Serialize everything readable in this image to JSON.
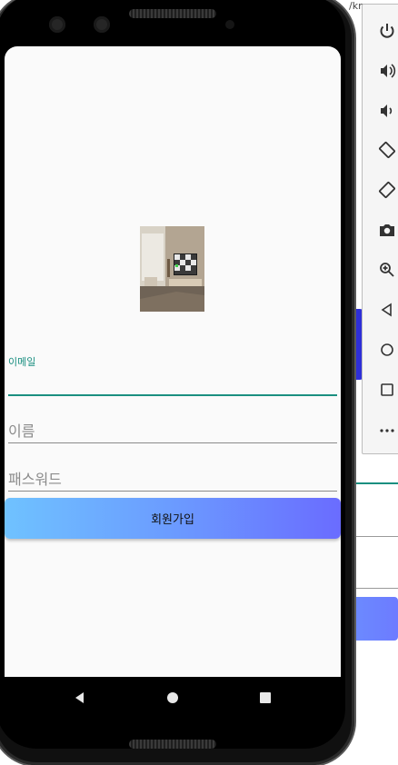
{
  "background": {
    "url_fragment": "/kn"
  },
  "emulator_panel": {
    "buttons": [
      {
        "icon": "power-icon"
      },
      {
        "icon": "volume-up-icon"
      },
      {
        "icon": "volume-down-icon"
      },
      {
        "icon": "rotate-left-icon"
      },
      {
        "icon": "rotate-right-icon"
      },
      {
        "icon": "camera-icon"
      },
      {
        "icon": "zoom-icon"
      },
      {
        "icon": "back-icon"
      },
      {
        "icon": "home-icon"
      },
      {
        "icon": "overview-icon"
      },
      {
        "icon": "more-icon"
      }
    ]
  },
  "form": {
    "email": {
      "label": "이메일",
      "value": ""
    },
    "name": {
      "placeholder": "이름"
    },
    "password": {
      "placeholder": "패스워드"
    },
    "signup_label": "회원가입"
  },
  "nav": {
    "back": "back-triangle-icon",
    "home": "home-circle-icon",
    "recents": "recents-square-icon"
  },
  "colors": {
    "accent": "#1a8f80",
    "button_gradient_start": "#6fc2ff",
    "button_gradient_end": "#6a6cff",
    "screen_bg": "#fafafa"
  }
}
